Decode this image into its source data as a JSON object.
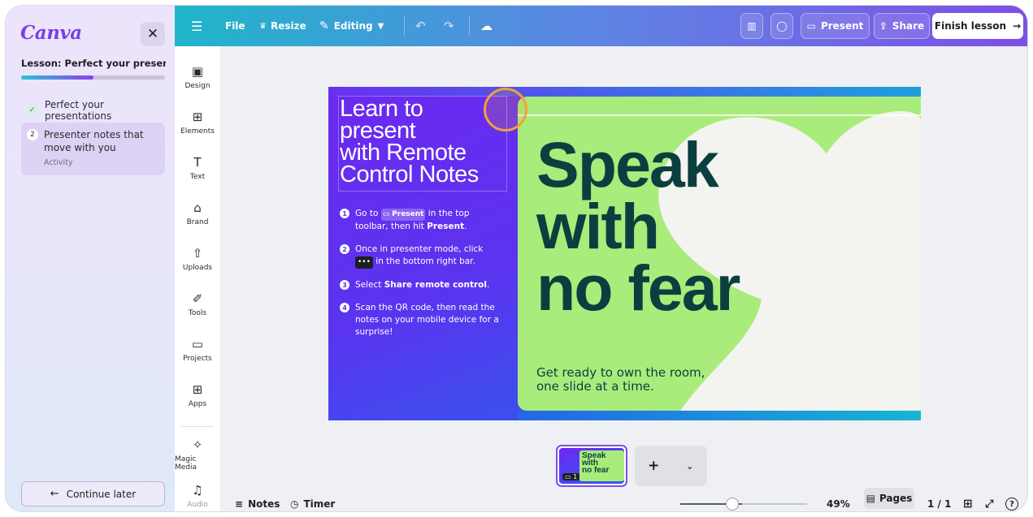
{
  "brand": {
    "logo_text": "Canva"
  },
  "lesson": {
    "title": "Lesson: Perfect your presentati...",
    "progress": 0.5,
    "close_icon": "close-icon",
    "steps": [
      {
        "label": "Perfect your presentations",
        "status": "done"
      },
      {
        "number": "2",
        "label": "Presenter notes that move with you",
        "sub": "Activity",
        "status": "active"
      }
    ],
    "continue_label": "Continue later"
  },
  "toolbar": {
    "file": "File",
    "resize": "Resize",
    "editing": "Editing",
    "present": "Present",
    "share": "Share",
    "finish": "Finish lesson"
  },
  "rail": {
    "items": [
      {
        "label": "Design",
        "icon": "layout-icon"
      },
      {
        "label": "Elements",
        "icon": "shapes-icon"
      },
      {
        "label": "Text",
        "icon": "text-icon"
      },
      {
        "label": "Brand",
        "icon": "brand-icon"
      },
      {
        "label": "Uploads",
        "icon": "upload-icon"
      },
      {
        "label": "Tools",
        "icon": "pen-icon"
      },
      {
        "label": "Projects",
        "icon": "folder-icon"
      },
      {
        "label": "Apps",
        "icon": "apps-icon"
      },
      {
        "label": "Magic Media",
        "icon": "magic-media-icon"
      },
      {
        "label": "Audio",
        "icon": "music-icon"
      }
    ]
  },
  "slide": {
    "heading_lines": [
      "Learn to",
      "present",
      "with Remote",
      "Control Notes"
    ],
    "instructions": [
      {
        "n": "1",
        "a": "Go to ",
        "chip": "Present",
        "b": " in the top toolbar, then hit ",
        "bold2": "Present",
        "c": "."
      },
      {
        "n": "2",
        "a": "Once in presenter mode, click ",
        "chip": "•••",
        "b": " in the bottom right bar."
      },
      {
        "n": "3",
        "a": "Select ",
        "bold": "Share remote control",
        "b": "."
      },
      {
        "n": "4",
        "a": "Scan the QR code, then read the notes on your mobile device for a surprise!"
      }
    ],
    "big_lines": [
      "Speak",
      "with",
      "no fear"
    ],
    "tagline_lines": [
      "Get ready to own the room,",
      "one slide at a time."
    ]
  },
  "thumbnail": {
    "text_lines": [
      "Speak",
      "with",
      "no fear"
    ],
    "badge": "1"
  },
  "bottombar": {
    "notes": "Notes",
    "timer": "Timer",
    "zoom": "49%",
    "zoom_value": 0.49,
    "pages": "Pages",
    "page_count": "1 / 1",
    "help": "?"
  },
  "colors": {
    "accent": "#7d4fe6",
    "toolbar_start": "#1fb5c9",
    "toolbar_end": "#7d4fe6",
    "slide_green": "#a9ec7b",
    "slide_text": "#0b3f3f",
    "cursor_ring": "#f0a13c"
  }
}
